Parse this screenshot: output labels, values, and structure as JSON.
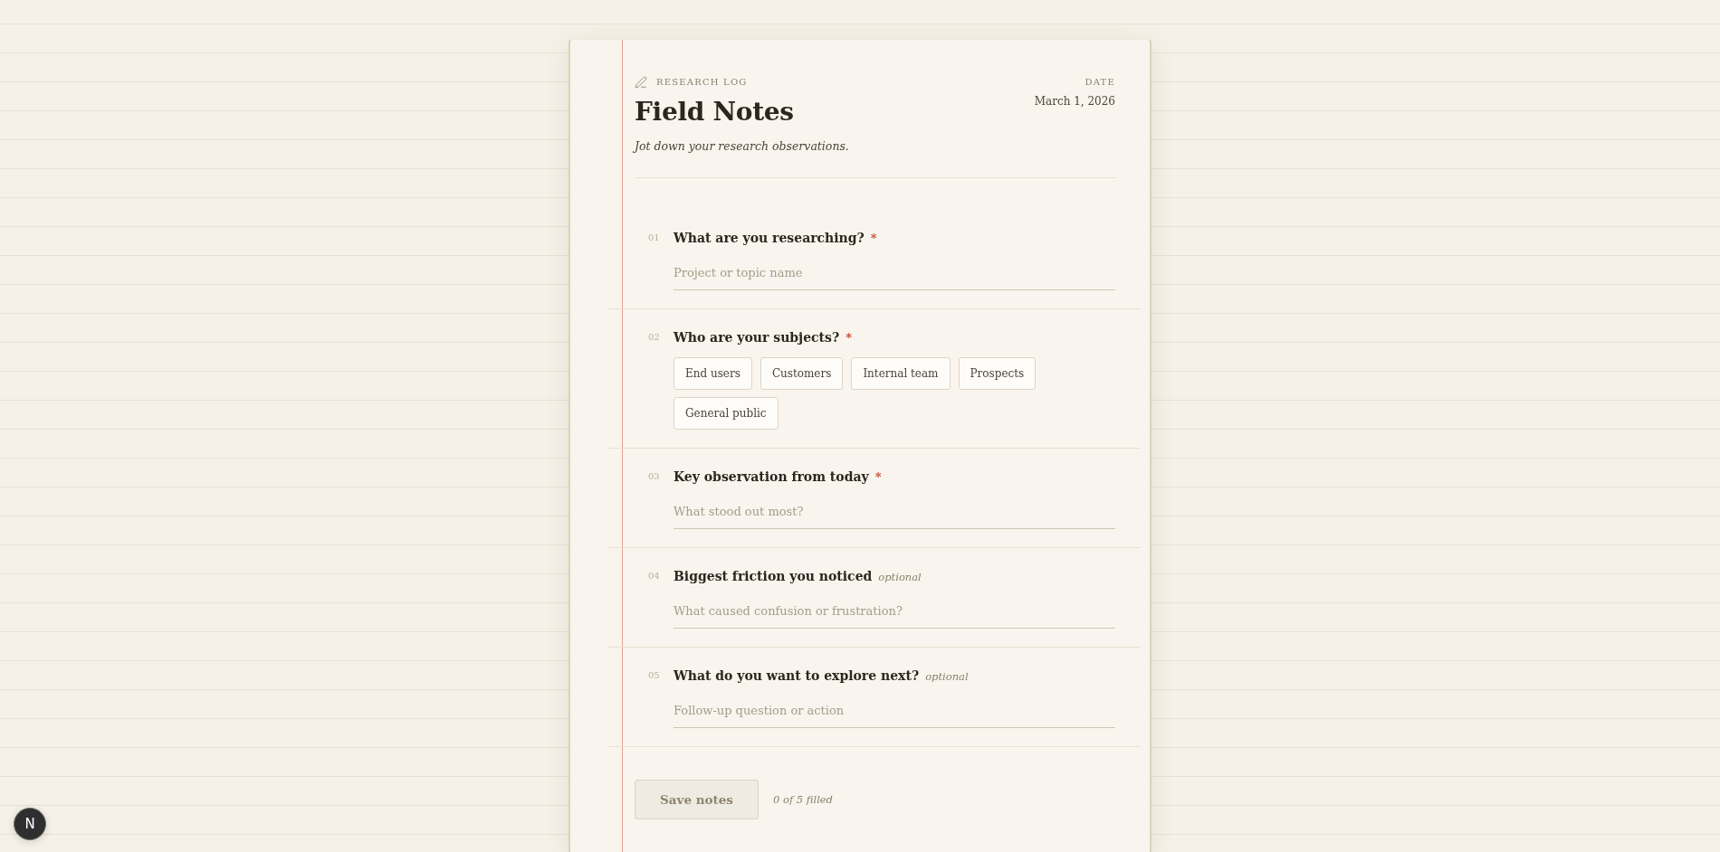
{
  "header": {
    "eyebrow": "RESEARCH LOG",
    "title": "Field Notes",
    "subtitle": "Jot down your research observations.",
    "date_label": "DATE",
    "date": "March 1, 2026"
  },
  "questions": [
    {
      "number": "01",
      "label": "What are you researching?",
      "requirement": {
        "kind": "required",
        "text": "*"
      },
      "kind": "text",
      "placeholder": "Project or topic name"
    },
    {
      "number": "02",
      "label": "Who are your subjects?",
      "requirement": {
        "kind": "required",
        "text": "*"
      },
      "kind": "choice",
      "options": [
        {
          "label": "End users",
          "selected": false
        },
        {
          "label": "Customers",
          "selected": false
        },
        {
          "label": "Internal team",
          "selected": false
        },
        {
          "label": "Prospects",
          "selected": false
        },
        {
          "label": "General public",
          "selected": false
        }
      ]
    },
    {
      "number": "03",
      "label": "Key observation from today",
      "requirement": {
        "kind": "required",
        "text": "*"
      },
      "kind": "text",
      "placeholder": "What stood out most?"
    },
    {
      "number": "04",
      "label": "Biggest friction you noticed",
      "requirement": {
        "kind": "optional",
        "text": "optional"
      },
      "kind": "text",
      "placeholder": "What caused confusion or frustration?"
    },
    {
      "number": "05",
      "label": "What do you want to explore next?",
      "requirement": {
        "kind": "optional",
        "text": "optional"
      },
      "kind": "text",
      "placeholder": "Follow-up question or action"
    }
  ],
  "footer": {
    "save_button": {
      "label": "Save notes",
      "disabled": true
    },
    "progress": "0 of 5 filled"
  },
  "dev_badge": {
    "label": "N"
  }
}
